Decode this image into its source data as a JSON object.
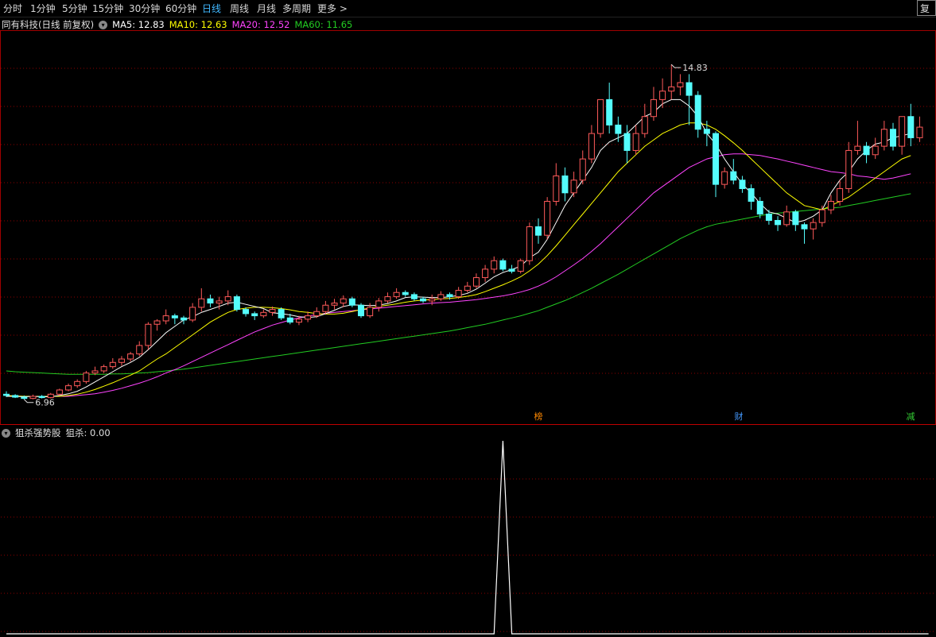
{
  "toolbar": {
    "periods": [
      "分时",
      "1分钟",
      "5分钟",
      "15分钟",
      "30分钟",
      "60分钟",
      "日线",
      "周线",
      "月线",
      "多周期",
      "更多 >"
    ],
    "active_index": 6,
    "restore_label": "复权"
  },
  "main_chart": {
    "title": "同有科技(日线 前复权)",
    "ma5": "MA5: 12.83",
    "ma10": "MA10: 12.63",
    "ma20": "MA20: 12.52",
    "ma60": "MA60: 11.65",
    "high_label": "14.83",
    "low_label": "6.96",
    "colors": {
      "up": "#ff5a5a",
      "down": "#54fcfc",
      "ma5": "#ffffff",
      "ma10": "#ffff00",
      "ma20": "#ff44ff",
      "ma60": "#22cc22",
      "grid": "#8b0000"
    }
  },
  "event_markers": [
    {
      "label": "榜",
      "color": "#ff8800"
    },
    {
      "label": "财",
      "color": "#4499ff"
    },
    {
      "label": "减",
      "color": "#33cc33"
    }
  ],
  "sub_chart": {
    "indicator_name": "狙杀强势股",
    "value_label": "狙杀: 0.00"
  },
  "chart_data": {
    "type": "candlestick",
    "price_range": [
      6.7,
      15.6
    ],
    "candles": [
      [
        7.05,
        7.02,
        7.12,
        6.98
      ],
      [
        7.02,
        6.98,
        7.05,
        6.96
      ],
      [
        6.98,
        6.95,
        7.02,
        6.93
      ],
      [
        6.95,
        7.0,
        7.04,
        6.93
      ],
      [
        7.0,
        6.97,
        7.03,
        6.95
      ],
      [
        6.97,
        7.05,
        7.08,
        6.95
      ],
      [
        7.05,
        7.15,
        7.18,
        7.02
      ],
      [
        7.15,
        7.25,
        7.3,
        7.12
      ],
      [
        7.25,
        7.35,
        7.4,
        7.2
      ],
      [
        7.35,
        7.55,
        7.6,
        7.3
      ],
      [
        7.55,
        7.6,
        7.7,
        7.5
      ],
      [
        7.6,
        7.7,
        7.75,
        7.55
      ],
      [
        7.7,
        7.8,
        7.9,
        7.65
      ],
      [
        7.8,
        7.88,
        7.95,
        7.72
      ],
      [
        7.88,
        8.0,
        8.05,
        7.82
      ],
      [
        8.0,
        8.2,
        8.3,
        7.95
      ],
      [
        8.2,
        8.7,
        8.75,
        8.1
      ],
      [
        8.7,
        8.78,
        8.82,
        8.55
      ],
      [
        8.78,
        8.9,
        9.05,
        8.7
      ],
      [
        8.9,
        8.85,
        8.95,
        8.7
      ],
      [
        8.85,
        8.8,
        8.9,
        8.7
      ],
      [
        8.8,
        9.1,
        9.2,
        8.75
      ],
      [
        9.1,
        9.3,
        9.55,
        9.0
      ],
      [
        9.3,
        9.2,
        9.4,
        9.1
      ],
      [
        9.2,
        9.25,
        9.35,
        9.05
      ],
      [
        9.25,
        9.35,
        9.5,
        9.15
      ],
      [
        9.35,
        9.05,
        9.4,
        9.0
      ],
      [
        9.05,
        8.95,
        9.1,
        8.88
      ],
      [
        8.95,
        8.9,
        9.0,
        8.8
      ],
      [
        8.9,
        8.98,
        9.05,
        8.85
      ],
      [
        8.98,
        9.05,
        9.12,
        8.9
      ],
      [
        9.05,
        8.85,
        9.1,
        8.8
      ],
      [
        8.85,
        8.75,
        8.95,
        8.7
      ],
      [
        8.75,
        8.82,
        8.9,
        8.68
      ],
      [
        8.82,
        8.9,
        9.0,
        8.75
      ],
      [
        8.9,
        9.0,
        9.1,
        8.85
      ],
      [
        9.0,
        9.15,
        9.25,
        8.95
      ],
      [
        9.15,
        9.2,
        9.3,
        9.05
      ],
      [
        9.2,
        9.3,
        9.38,
        9.1
      ],
      [
        9.3,
        9.15,
        9.35,
        9.1
      ],
      [
        9.15,
        8.9,
        9.2,
        8.85
      ],
      [
        8.9,
        9.1,
        9.2,
        8.85
      ],
      [
        9.1,
        9.25,
        9.32,
        9.0
      ],
      [
        9.25,
        9.35,
        9.45,
        9.2
      ],
      [
        9.35,
        9.45,
        9.55,
        9.3
      ],
      [
        9.45,
        9.4,
        9.5,
        9.35
      ],
      [
        9.4,
        9.3,
        9.45,
        9.25
      ],
      [
        9.3,
        9.25,
        9.35,
        9.2
      ],
      [
        9.25,
        9.3,
        9.4,
        9.15
      ],
      [
        9.3,
        9.4,
        9.48,
        9.25
      ],
      [
        9.4,
        9.35,
        9.45,
        9.28
      ],
      [
        9.35,
        9.5,
        9.58,
        9.3
      ],
      [
        9.5,
        9.6,
        9.7,
        9.45
      ],
      [
        9.6,
        9.8,
        9.9,
        9.55
      ],
      [
        9.8,
        10.0,
        10.1,
        9.7
      ],
      [
        10.0,
        10.2,
        10.3,
        9.9
      ],
      [
        10.2,
        10.0,
        10.25,
        9.95
      ],
      [
        10.0,
        9.95,
        10.1,
        9.9
      ],
      [
        9.95,
        10.2,
        10.25,
        9.9
      ],
      [
        10.2,
        11.0,
        11.1,
        10.1
      ],
      [
        11.0,
        10.8,
        11.2,
        10.6
      ],
      [
        10.8,
        11.6,
        11.7,
        10.7
      ],
      [
        11.6,
        12.2,
        12.5,
        11.5
      ],
      [
        12.2,
        11.8,
        12.4,
        11.6
      ],
      [
        11.8,
        12.1,
        12.3,
        11.7
      ],
      [
        12.1,
        12.6,
        12.8,
        12.0
      ],
      [
        12.6,
        13.2,
        13.4,
        12.5
      ],
      [
        13.2,
        14.0,
        14.0,
        13.1
      ],
      [
        14.0,
        13.4,
        14.4,
        13.2
      ],
      [
        13.4,
        13.2,
        13.6,
        13.0
      ],
      [
        13.2,
        12.8,
        13.4,
        12.5
      ],
      [
        12.8,
        13.2,
        13.4,
        12.7
      ],
      [
        13.2,
        13.6,
        13.9,
        13.1
      ],
      [
        13.6,
        14.0,
        14.3,
        13.5
      ],
      [
        14.0,
        14.2,
        14.5,
        13.8
      ],
      [
        14.2,
        14.3,
        14.83,
        14.0
      ],
      [
        14.3,
        14.4,
        14.6,
        14.1
      ],
      [
        14.4,
        14.1,
        14.6,
        13.4
      ],
      [
        14.1,
        13.3,
        14.2,
        13.1
      ],
      [
        13.3,
        13.2,
        13.5,
        12.9
      ],
      [
        13.2,
        12.0,
        13.25,
        11.7
      ],
      [
        12.0,
        12.3,
        12.4,
        11.9
      ],
      [
        12.3,
        12.1,
        12.6,
        12.0
      ],
      [
        12.1,
        11.9,
        12.2,
        11.8
      ],
      [
        11.9,
        11.6,
        12.0,
        11.4
      ],
      [
        11.6,
        11.3,
        11.7,
        11.2
      ],
      [
        11.3,
        11.15,
        11.4,
        11.05
      ],
      [
        11.15,
        11.05,
        11.25,
        10.9
      ],
      [
        11.05,
        11.35,
        11.5,
        11.0
      ],
      [
        11.35,
        11.05,
        11.4,
        10.9
      ],
      [
        11.05,
        10.95,
        11.1,
        10.6
      ],
      [
        10.95,
        11.1,
        11.2,
        10.7
      ],
      [
        11.1,
        11.4,
        11.5,
        11.0
      ],
      [
        11.4,
        11.6,
        11.75,
        11.3
      ],
      [
        11.6,
        11.9,
        12.1,
        11.5
      ],
      [
        11.9,
        12.8,
        13.0,
        11.8
      ],
      [
        12.8,
        12.9,
        13.5,
        12.7
      ],
      [
        12.9,
        12.7,
        13.0,
        12.5
      ],
      [
        12.7,
        12.9,
        13.1,
        12.6
      ],
      [
        12.9,
        13.3,
        13.5,
        12.8
      ],
      [
        13.3,
        12.9,
        13.45,
        12.8
      ],
      [
        12.9,
        13.6,
        13.6,
        12.7
      ],
      [
        13.6,
        13.1,
        13.9,
        12.9
      ],
      [
        13.1,
        13.35,
        13.6,
        13.0
      ]
    ],
    "ma5": [
      7.0,
      7.0,
      6.99,
      7.0,
      6.99,
      6.99,
      7.02,
      7.06,
      7.12,
      7.22,
      7.34,
      7.46,
      7.58,
      7.7,
      7.8,
      7.92,
      8.1,
      8.3,
      8.5,
      8.65,
      8.8,
      8.88,
      8.98,
      9.05,
      9.12,
      9.2,
      9.22,
      9.17,
      9.12,
      9.07,
      8.97,
      8.95,
      8.92,
      8.88,
      8.86,
      8.88,
      8.95,
      9.03,
      9.12,
      9.16,
      9.15,
      9.14,
      9.15,
      9.19,
      9.25,
      9.33,
      9.35,
      9.34,
      9.33,
      9.33,
      9.35,
      9.38,
      9.43,
      9.53,
      9.67,
      9.82,
      9.92,
      9.99,
      10.07,
      10.27,
      10.4,
      10.7,
      11.1,
      11.5,
      11.8,
      12.1,
      12.4,
      12.8,
      13.0,
      13.1,
      13.2,
      13.4,
      13.6,
      13.7,
      13.9,
      14.0,
      14.0,
      13.85,
      13.6,
      13.2,
      12.95,
      12.6,
      12.3,
      12.0,
      11.8,
      11.55,
      11.35,
      11.3,
      11.2,
      11.1,
      11.15,
      11.25,
      11.4,
      11.8,
      12.1,
      12.3,
      12.6,
      12.8,
      12.95,
      13.0,
      13.1,
      13.15,
      13.2
    ],
    "ma10": [
      7.02,
      7.01,
      7.0,
      7.0,
      7.0,
      7.0,
      7.0,
      7.02,
      7.05,
      7.1,
      7.16,
      7.24,
      7.32,
      7.41,
      7.5,
      7.6,
      7.74,
      7.88,
      8.0,
      8.15,
      8.3,
      8.45,
      8.6,
      8.75,
      8.87,
      8.98,
      9.05,
      9.08,
      9.1,
      9.1,
      9.09,
      9.07,
      9.04,
      9.0,
      8.98,
      8.95,
      8.94,
      8.94,
      8.96,
      9.0,
      9.05,
      9.08,
      9.12,
      9.15,
      9.18,
      9.22,
      9.25,
      9.27,
      9.28,
      9.3,
      9.31,
      9.33,
      9.36,
      9.4,
      9.47,
      9.55,
      9.63,
      9.72,
      9.82,
      9.96,
      10.12,
      10.32,
      10.55,
      10.8,
      11.05,
      11.3,
      11.55,
      11.8,
      12.05,
      12.3,
      12.5,
      12.7,
      12.9,
      13.05,
      13.2,
      13.3,
      13.4,
      13.45,
      13.45,
      13.4,
      13.3,
      13.15,
      12.98,
      12.8,
      12.6,
      12.4,
      12.2,
      12.0,
      11.8,
      11.65,
      11.5,
      11.45,
      11.4,
      11.5,
      11.6,
      11.7,
      11.85,
      12.0,
      12.15,
      12.3,
      12.45,
      12.6,
      12.68
    ],
    "ma20": [
      7.0,
      7.0,
      7.0,
      7.0,
      7.0,
      7.0,
      7.0,
      7.0,
      7.02,
      7.04,
      7.06,
      7.1,
      7.14,
      7.19,
      7.25,
      7.31,
      7.38,
      7.46,
      7.55,
      7.63,
      7.72,
      7.82,
      7.92,
      8.02,
      8.12,
      8.22,
      8.32,
      8.42,
      8.52,
      8.6,
      8.68,
      8.74,
      8.8,
      8.85,
      8.89,
      8.93,
      8.96,
      8.98,
      9.0,
      9.02,
      9.04,
      9.06,
      9.08,
      9.1,
      9.12,
      9.14,
      9.16,
      9.18,
      9.2,
      9.21,
      9.22,
      9.24,
      9.26,
      9.28,
      9.31,
      9.34,
      9.37,
      9.41,
      9.46,
      9.52,
      9.6,
      9.7,
      9.82,
      9.96,
      10.1,
      10.25,
      10.42,
      10.6,
      10.8,
      11.0,
      11.2,
      11.4,
      11.6,
      11.8,
      11.95,
      12.1,
      12.25,
      12.4,
      12.5,
      12.6,
      12.65,
      12.7,
      12.72,
      12.72,
      12.7,
      12.68,
      12.64,
      12.6,
      12.55,
      12.5,
      12.45,
      12.4,
      12.35,
      12.3,
      12.28,
      12.25,
      12.2,
      12.18,
      12.15,
      12.12,
      12.15,
      12.2,
      12.25
    ],
    "ma60": [
      7.6,
      7.58,
      7.57,
      7.56,
      7.55,
      7.54,
      7.53,
      7.52,
      7.52,
      7.52,
      7.52,
      7.52,
      7.53,
      7.53,
      7.54,
      7.55,
      7.56,
      7.58,
      7.6,
      7.62,
      7.64,
      7.67,
      7.7,
      7.73,
      7.76,
      7.79,
      7.82,
      7.85,
      7.88,
      7.91,
      7.94,
      7.97,
      8.0,
      8.03,
      8.06,
      8.09,
      8.12,
      8.15,
      8.18,
      8.21,
      8.24,
      8.27,
      8.3,
      8.33,
      8.36,
      8.39,
      8.42,
      8.45,
      8.48,
      8.51,
      8.54,
      8.58,
      8.62,
      8.66,
      8.7,
      8.75,
      8.8,
      8.85,
      8.9,
      8.96,
      9.02,
      9.1,
      9.18,
      9.26,
      9.35,
      9.45,
      9.55,
      9.66,
      9.77,
      9.88,
      10.0,
      10.12,
      10.24,
      10.36,
      10.48,
      10.6,
      10.72,
      10.82,
      10.92,
      11.0,
      11.06,
      11.1,
      11.14,
      11.18,
      11.22,
      11.26,
      11.3,
      11.32,
      11.34,
      11.36,
      11.38,
      11.4,
      11.42,
      11.44,
      11.46,
      11.5,
      11.54,
      11.58,
      11.62,
      11.66,
      11.7,
      11.74,
      11.78
    ],
    "signal_values": [
      0,
      0,
      0,
      0,
      0,
      0,
      0,
      0,
      0,
      0,
      0,
      0,
      0,
      0,
      0,
      0,
      0,
      0,
      0,
      0,
      0,
      0,
      0,
      0,
      0,
      0,
      0,
      0,
      0,
      0,
      0,
      0,
      0,
      0,
      0,
      0,
      0,
      0,
      0,
      0,
      0,
      0,
      0,
      0,
      0,
      0,
      0,
      0,
      0,
      0,
      0,
      0,
      0,
      0,
      0,
      0,
      0,
      0,
      0,
      0,
      0,
      0,
      0,
      0,
      0,
      0,
      0,
      0,
      0,
      0,
      0,
      0,
      0,
      0,
      0,
      0,
      0,
      0,
      0,
      0,
      0,
      0,
      0,
      0,
      0,
      0,
      0,
      0,
      0,
      0,
      0,
      0,
      0,
      0,
      0,
      0,
      0,
      0,
      0,
      0,
      0,
      0,
      0,
      0,
      0
    ],
    "signal_spike_index": 56,
    "signal_range": [
      0,
      1
    ]
  }
}
